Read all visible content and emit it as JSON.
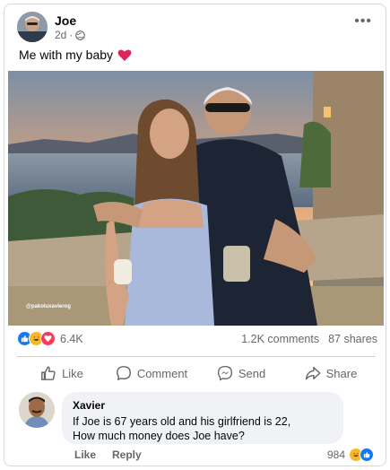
{
  "post": {
    "author": "Joe",
    "time": "2d",
    "privacy_icon": "globe-icon",
    "more_label": "•••",
    "caption": "Me with my baby",
    "caption_emoji": "heart-icon",
    "photo_watermark": "@pakoluxavierog"
  },
  "stats": {
    "reaction_count": "6.4K",
    "comments": "1.2K comments",
    "shares": "87 shares",
    "reaction_icons": [
      "like-icon",
      "haha-icon",
      "love-icon"
    ]
  },
  "actions": [
    {
      "label": "Like",
      "icon": "thumbs-up-icon"
    },
    {
      "label": "Comment",
      "icon": "comment-icon"
    },
    {
      "label": "Send",
      "icon": "messenger-icon"
    },
    {
      "label": "Share",
      "icon": "share-icon"
    }
  ],
  "comment": {
    "author": "Xavier",
    "text_line1": "If Joe is 67 years old and his girlfriend is 22,",
    "text_line2": "How much money does Joe have?",
    "like_label": "Like",
    "reply_label": "Reply",
    "reaction_count": "984"
  },
  "colors": {
    "facebook_blue": "#1877f2",
    "love_red": "#f33e58",
    "haha_yellow": "#f7b928",
    "secondary_text": "#65676b"
  }
}
